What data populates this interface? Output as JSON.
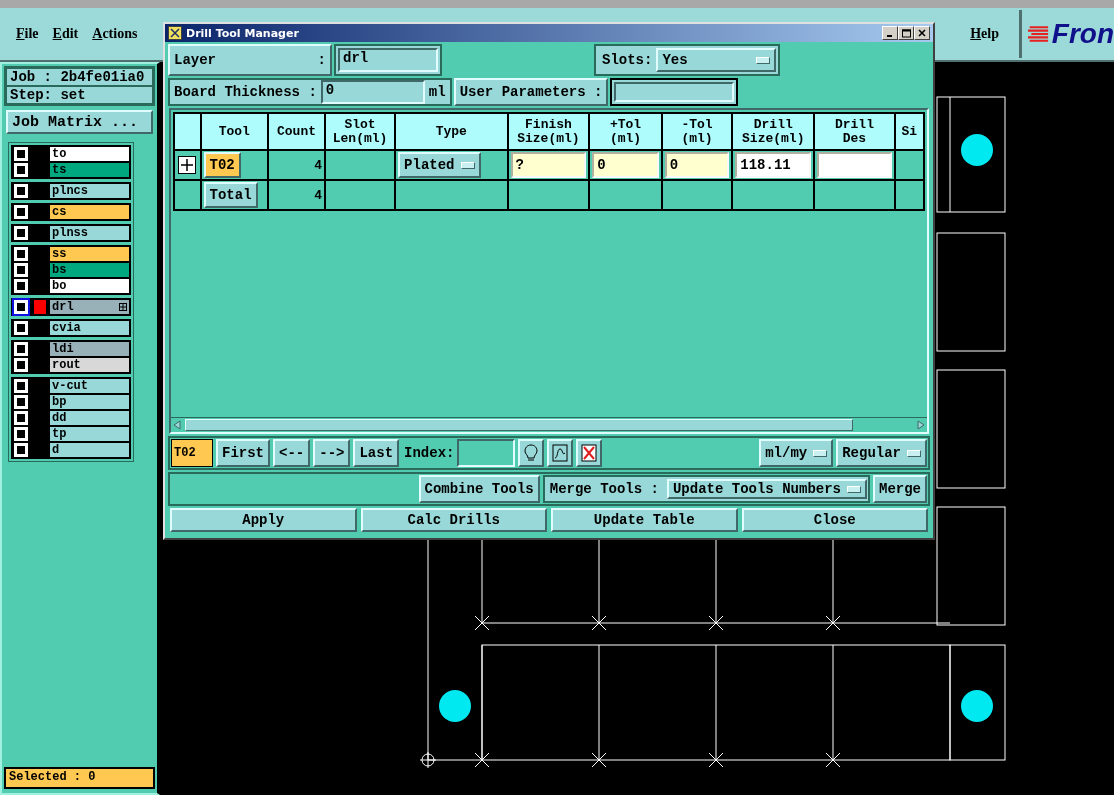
{
  "menu": {
    "items": [
      "File",
      "Edit",
      "Actions"
    ],
    "help": "Help",
    "logo": "Fron"
  },
  "job_panel": {
    "job": "Job : 2b4fe01ia0",
    "step": "Step: set",
    "matrix_button": "Job Matrix ...",
    "layer_groups": [
      {
        "layers": [
          {
            "name": "to",
            "color": "#ffffff",
            "selected": false
          },
          {
            "name": "ts",
            "color": "#00a880",
            "selected": false
          }
        ]
      },
      {
        "layers": [
          {
            "name": "plncs",
            "color": "#98d8d8",
            "selected": false
          }
        ]
      },
      {
        "layers": [
          {
            "name": "cs",
            "color": "#ffc850",
            "selected": false
          }
        ]
      },
      {
        "layers": [
          {
            "name": "plnss",
            "color": "#98d8d8",
            "selected": false
          }
        ]
      },
      {
        "layers": [
          {
            "name": "ss",
            "color": "#ffc850",
            "selected": false
          },
          {
            "name": "bs",
            "color": "#00a880",
            "selected": false
          },
          {
            "name": "bo",
            "color": "#ffffff",
            "selected": false
          }
        ]
      },
      {
        "layers": [
          {
            "name": "drl",
            "color": "#98b0b8",
            "selected": true
          }
        ]
      },
      {
        "layers": [
          {
            "name": "cvia",
            "color": "#98d8d8",
            "selected": false
          }
        ]
      },
      {
        "layers": [
          {
            "name": "ldi",
            "color": "#98b0b8",
            "selected": false
          },
          {
            "name": "rout",
            "color": "#d8d8d8",
            "selected": false
          }
        ]
      },
      {
        "layers": [
          {
            "name": "v-cut",
            "color": "#98d8d8",
            "selected": false
          },
          {
            "name": "bp",
            "color": "#98d8d8",
            "selected": false
          },
          {
            "name": "dd",
            "color": "#98d8d8",
            "selected": false
          },
          {
            "name": "tp",
            "color": "#98d8d8",
            "selected": false
          },
          {
            "name": "d",
            "color": "#98d8d8",
            "selected": false
          }
        ]
      }
    ],
    "selected": "Selected : 0"
  },
  "dialog": {
    "title": "Drill Tool Manager",
    "layer": {
      "label": "Layer",
      "separator": ":",
      "value": "drl"
    },
    "slots": {
      "label": "Slots:",
      "value": "Yes"
    },
    "board_thickness": {
      "label": "Board Thickness :",
      "value": "0",
      "unit": "ml"
    },
    "user_parameters": {
      "label": "User Parameters :"
    },
    "table": {
      "columns": [
        "",
        "Tool",
        "Count",
        "Slot\nLen(ml)",
        "Type",
        "Finish\nSize(ml)",
        "+Tol\n(ml)",
        "-Tol\n(ml)",
        "Drill\nSize(ml)",
        "Drill\nDes",
        "Si"
      ],
      "rows": [
        {
          "kind": "tool",
          "tool": "T02",
          "count": "4",
          "type": "Plated",
          "finish_size": "?",
          "plus_tol": "0",
          "minus_tol": "0",
          "drill_size": "118.11"
        },
        {
          "kind": "total",
          "tool": "Total",
          "count": "4"
        }
      ]
    },
    "nav": {
      "current": "T02",
      "buttons": [
        "First",
        "<--",
        "-->",
        "Last"
      ],
      "index_label": "Index:",
      "units": "ml/my",
      "mode": "Regular"
    },
    "merge": {
      "combine": "Combine Tools",
      "label": "Merge Tools :",
      "option": "Update Tools Numbers",
      "button": "Merge"
    },
    "actions": [
      "Apply",
      "Calc Drills",
      "Update Table",
      "Close"
    ]
  }
}
